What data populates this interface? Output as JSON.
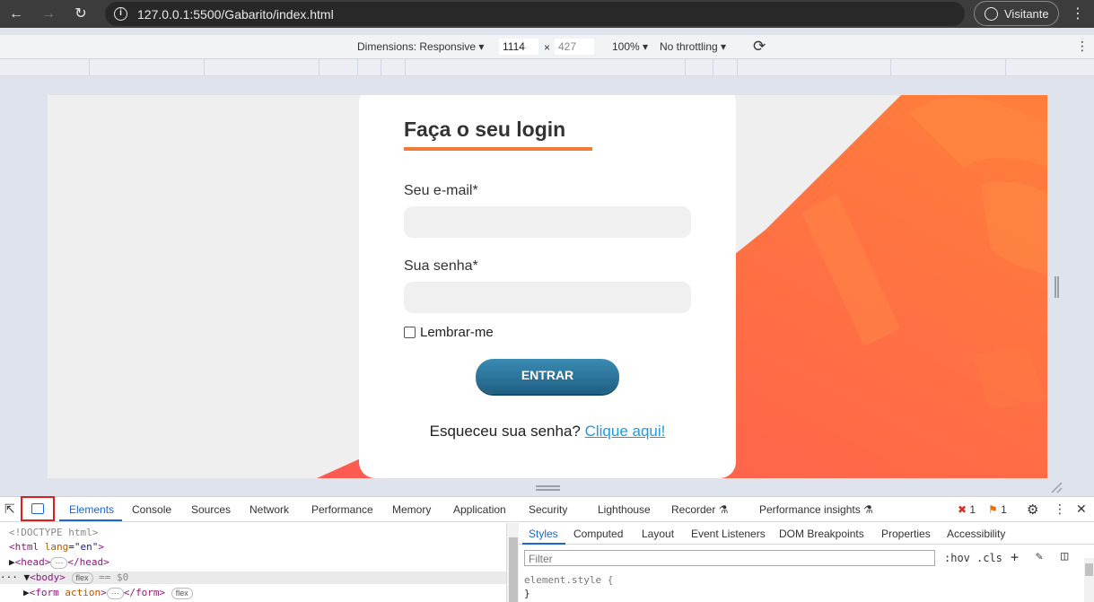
{
  "browser": {
    "url": "127.0.0.1:5500/Gabarito/index.html",
    "profile_label": "Visitante"
  },
  "device_toolbar": {
    "dimensions_label": "Dimensions: Responsive",
    "width": "1114",
    "times": "×",
    "height": "427",
    "zoom": "100%",
    "throttling": "No throttling"
  },
  "login": {
    "title": "Faça o seu login",
    "email_label": "Seu e-mail*",
    "password_label": "Sua senha*",
    "remember_label": "Lembrar-me",
    "submit_label": "ENTRAR",
    "forgot_text": "Esqueceu sua senha?",
    "forgot_link": "Clique aqui!"
  },
  "devtools": {
    "tabs": [
      "Elements",
      "Console",
      "Sources",
      "Network",
      "Performance",
      "Memory",
      "Application",
      "Security",
      "Lighthouse",
      "Recorder",
      "Performance insights"
    ],
    "errors": "1",
    "warnings": "1",
    "dom_lines": {
      "doctype": "<!DOCTYPE html>",
      "html_open": "<html",
      "html_attr": "lang",
      "html_val": "\"en\"",
      "head": "<head>",
      "head_close": "</head>",
      "body": "<body>",
      "body_eq": "== $0",
      "form": "<form",
      "form_attr": "action",
      "form_close": "</form>",
      "flex": "flex",
      "ellipsis": "···",
      "close_bracket": ">"
    },
    "styles_tabs": [
      "Styles",
      "Computed",
      "Layout",
      "Event Listeners",
      "DOM Breakpoints",
      "Properties",
      "Accessibility"
    ],
    "filter_placeholder": "Filter",
    "hov": ":hov",
    "cls": ".cls",
    "element_style": "element.style {",
    "close_brace": "}"
  }
}
